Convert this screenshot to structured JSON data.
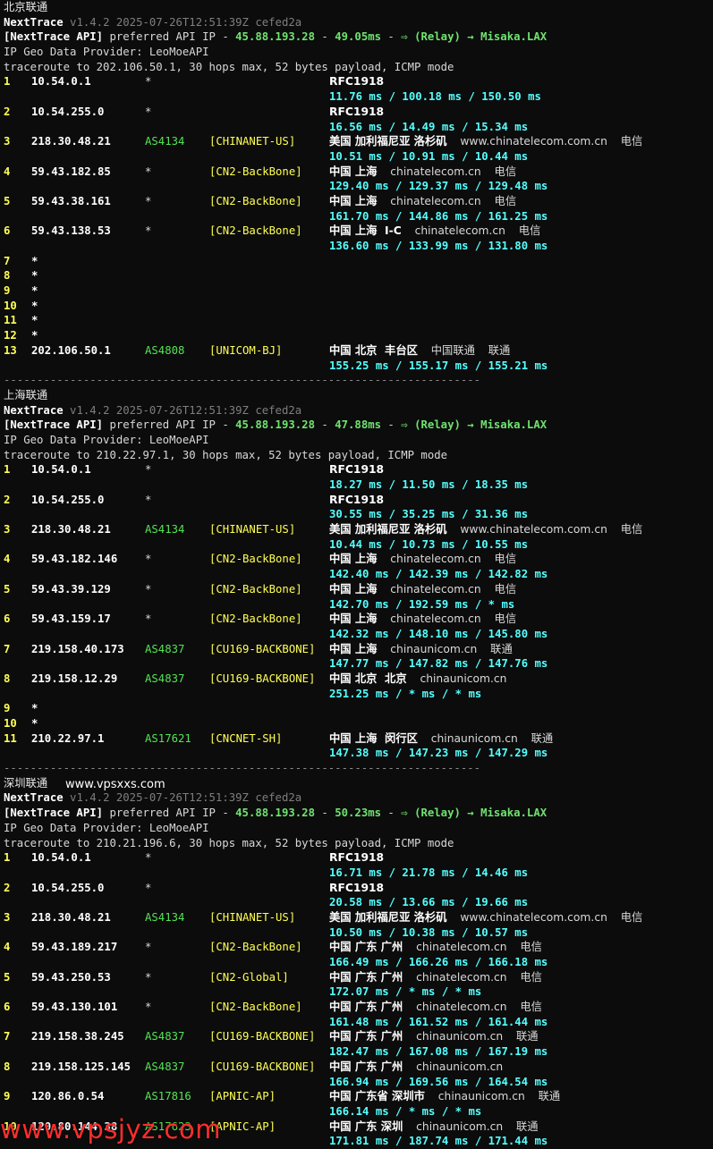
{
  "watermark": {
    "site": "www.vpsxxs.com",
    "brand": "www.vpsjyz.com"
  },
  "sections": [
    {
      "title": "北京联通",
      "app": "NextTrace",
      "version": "v1.4.2 2025-07-26T12:51:39Z cefed2a",
      "api_tag": "[NextTrace API]",
      "api_text": "preferred API IP -",
      "api_ip": "45.88.193.28",
      "api_ms": "49.05ms",
      "api_route": "(Relay) → Misaka.LAX",
      "geo_provider": "IP Geo Data Provider: LeoMoeAPI",
      "traceroute": "traceroute to 202.106.50.1, 30 hops max, 52 bytes payload, ICMP mode",
      "hops": [
        {
          "n": "1",
          "ip": "10.54.0.1",
          "asn": "*",
          "tag": "",
          "geo": "RFC1918",
          "domain": "",
          "isp": "",
          "rtt": "11.76 ms / 100.18 ms / 150.50 ms"
        },
        {
          "n": "2",
          "ip": "10.54.255.0",
          "asn": "*",
          "tag": "",
          "geo": "RFC1918",
          "domain": "",
          "isp": "",
          "rtt": "16.56 ms / 14.49 ms / 15.34 ms"
        },
        {
          "n": "3",
          "ip": "218.30.48.21",
          "asn": "AS4134",
          "tag": "[CHINANET-US]",
          "geo": "美国 加利福尼亚 洛杉矶",
          "domain": "www.chinatelecom.com.cn",
          "isp": "电信",
          "rtt": "10.51 ms / 10.91 ms / 10.44 ms"
        },
        {
          "n": "4",
          "ip": "59.43.182.85",
          "asn": "*",
          "tag": "[CN2-BackBone]",
          "geo": "中国 上海",
          "domain": "chinatelecom.cn",
          "isp": "电信",
          "rtt": "129.40 ms / 129.37 ms / 129.48 ms"
        },
        {
          "n": "5",
          "ip": "59.43.38.161",
          "asn": "*",
          "tag": "[CN2-BackBone]",
          "geo": "中国 上海",
          "domain": "chinatelecom.cn",
          "isp": "电信",
          "rtt": "161.70 ms / 144.86 ms / 161.25 ms"
        },
        {
          "n": "6",
          "ip": "59.43.138.53",
          "asn": "*",
          "tag": "[CN2-BackBone]",
          "geo": "中国 上海  I-C",
          "domain": "chinatelecom.cn",
          "isp": "电信",
          "rtt": "136.60 ms / 133.99 ms / 131.80 ms"
        },
        {
          "n": "7",
          "ip": "*",
          "asn": "",
          "tag": "",
          "geo": "",
          "domain": "",
          "isp": "",
          "rtt": ""
        },
        {
          "n": "8",
          "ip": "*",
          "asn": "",
          "tag": "",
          "geo": "",
          "domain": "",
          "isp": "",
          "rtt": ""
        },
        {
          "n": "9",
          "ip": "*",
          "asn": "",
          "tag": "",
          "geo": "",
          "domain": "",
          "isp": "",
          "rtt": ""
        },
        {
          "n": "10",
          "ip": "*",
          "asn": "",
          "tag": "",
          "geo": "",
          "domain": "",
          "isp": "",
          "rtt": ""
        },
        {
          "n": "11",
          "ip": "*",
          "asn": "",
          "tag": "",
          "geo": "",
          "domain": "",
          "isp": "",
          "rtt": ""
        },
        {
          "n": "12",
          "ip": "*",
          "asn": "",
          "tag": "",
          "geo": "",
          "domain": "",
          "isp": "",
          "rtt": ""
        },
        {
          "n": "13",
          "ip": "202.106.50.1",
          "asn": "AS4808",
          "tag": "[UNICOM-BJ]",
          "geo": "中国 北京  丰台区",
          "domain": "中国联通",
          "isp": "联通",
          "rtt": "155.25 ms / 155.17 ms / 155.21 ms"
        }
      ],
      "separator": "------------------------------------------------------------------------"
    },
    {
      "title": "上海联通",
      "app": "NextTrace",
      "version": "v1.4.2 2025-07-26T12:51:39Z cefed2a",
      "api_tag": "[NextTrace API]",
      "api_text": "preferred API IP -",
      "api_ip": "45.88.193.28",
      "api_ms": "47.88ms",
      "api_route": "(Relay) → Misaka.LAX",
      "geo_provider": "IP Geo Data Provider: LeoMoeAPI",
      "traceroute": "traceroute to 210.22.97.1, 30 hops max, 52 bytes payload, ICMP mode",
      "hops": [
        {
          "n": "1",
          "ip": "10.54.0.1",
          "asn": "*",
          "tag": "",
          "geo": "RFC1918",
          "domain": "",
          "isp": "",
          "rtt": "18.27 ms / 11.50 ms / 18.35 ms"
        },
        {
          "n": "2",
          "ip": "10.54.255.0",
          "asn": "*",
          "tag": "",
          "geo": "RFC1918",
          "domain": "",
          "isp": "",
          "rtt": "30.55 ms / 35.25 ms / 31.36 ms"
        },
        {
          "n": "3",
          "ip": "218.30.48.21",
          "asn": "AS4134",
          "tag": "[CHINANET-US]",
          "geo": "美国 加利福尼亚 洛杉矶",
          "domain": "www.chinatelecom.com.cn",
          "isp": "电信",
          "rtt": "10.44 ms / 10.73 ms / 10.55 ms"
        },
        {
          "n": "4",
          "ip": "59.43.182.146",
          "asn": "*",
          "tag": "[CN2-BackBone]",
          "geo": "中国 上海",
          "domain": "chinatelecom.cn",
          "isp": "电信",
          "rtt": "142.40 ms / 142.39 ms / 142.82 ms"
        },
        {
          "n": "5",
          "ip": "59.43.39.129",
          "asn": "*",
          "tag": "[CN2-BackBone]",
          "geo": "中国 上海",
          "domain": "chinatelecom.cn",
          "isp": "电信",
          "rtt": "142.70 ms / 192.59 ms / * ms"
        },
        {
          "n": "6",
          "ip": "59.43.159.17",
          "asn": "*",
          "tag": "[CN2-BackBone]",
          "geo": "中国 上海",
          "domain": "chinatelecom.cn",
          "isp": "电信",
          "rtt": "142.32 ms / 148.10 ms / 145.80 ms"
        },
        {
          "n": "7",
          "ip": "219.158.40.173",
          "asn": "AS4837",
          "tag": "[CU169-BACKBONE]",
          "geo": "中国 上海",
          "domain": "chinaunicom.cn",
          "isp": "联通",
          "rtt": "147.77 ms / 147.82 ms / 147.76 ms"
        },
        {
          "n": "8",
          "ip": "219.158.12.29",
          "asn": "AS4837",
          "tag": "[CU169-BACKBONE]",
          "geo": "中国 北京  北京",
          "domain": "chinaunicom.cn",
          "isp": "",
          "rtt": "251.25 ms / * ms / * ms"
        },
        {
          "n": "9",
          "ip": "*",
          "asn": "",
          "tag": "",
          "geo": "",
          "domain": "",
          "isp": "",
          "rtt": ""
        },
        {
          "n": "10",
          "ip": "*",
          "asn": "",
          "tag": "",
          "geo": "",
          "domain": "",
          "isp": "",
          "rtt": ""
        },
        {
          "n": "11",
          "ip": "210.22.97.1",
          "asn": "AS17621",
          "tag": "[CNCNET-SH]",
          "geo": "中国 上海  闵行区",
          "domain": "chinaunicom.cn",
          "isp": "联通",
          "rtt": "147.38 ms / 147.23 ms / 147.29 ms"
        }
      ],
      "separator": "------------------------------------------------------------------------"
    },
    {
      "title": "深圳联通",
      "app": "NextTrace",
      "version": "v1.4.2 2025-07-26T12:51:39Z cefed2a",
      "api_tag": "[NextTrace API]",
      "api_text": "preferred API IP -",
      "api_ip": "45.88.193.28",
      "api_ms": "50.23ms",
      "api_route": "(Relay) → Misaka.LAX",
      "geo_provider": "IP Geo Data Provider: LeoMoeAPI",
      "traceroute": "traceroute to 210.21.196.6, 30 hops max, 52 bytes payload, ICMP mode",
      "hops": [
        {
          "n": "1",
          "ip": "10.54.0.1",
          "asn": "*",
          "tag": "",
          "geo": "RFC1918",
          "domain": "",
          "isp": "",
          "rtt": "16.71 ms / 21.78 ms / 14.46 ms"
        },
        {
          "n": "2",
          "ip": "10.54.255.0",
          "asn": "*",
          "tag": "",
          "geo": "RFC1918",
          "domain": "",
          "isp": "",
          "rtt": "20.58 ms / 13.66 ms / 19.66 ms"
        },
        {
          "n": "3",
          "ip": "218.30.48.21",
          "asn": "AS4134",
          "tag": "[CHINANET-US]",
          "geo": "美国 加利福尼亚 洛杉矶",
          "domain": "www.chinatelecom.com.cn",
          "isp": "电信",
          "rtt": "10.50 ms / 10.38 ms / 10.57 ms"
        },
        {
          "n": "4",
          "ip": "59.43.189.217",
          "asn": "*",
          "tag": "[CN2-BackBone]",
          "geo": "中国 广东 广州",
          "domain": "chinatelecom.cn",
          "isp": "电信",
          "rtt": "166.49 ms / 166.26 ms / 166.18 ms"
        },
        {
          "n": "5",
          "ip": "59.43.250.53",
          "asn": "*",
          "tag": "[CN2-Global]",
          "geo": "中国 广东 广州",
          "domain": "chinatelecom.cn",
          "isp": "电信",
          "rtt": "172.07 ms / * ms / * ms"
        },
        {
          "n": "6",
          "ip": "59.43.130.101",
          "asn": "*",
          "tag": "[CN2-BackBone]",
          "geo": "中国 广东 广州",
          "domain": "chinatelecom.cn",
          "isp": "电信",
          "rtt": "161.48 ms / 161.52 ms / 161.44 ms"
        },
        {
          "n": "7",
          "ip": "219.158.38.245",
          "asn": "AS4837",
          "tag": "[CU169-BACKBONE]",
          "geo": "中国 广东 广州",
          "domain": "chinaunicom.cn",
          "isp": "联通",
          "rtt": "182.47 ms / 167.08 ms / 167.19 ms"
        },
        {
          "n": "8",
          "ip": "219.158.125.145",
          "asn": "AS4837",
          "tag": "[CU169-BACKBONE]",
          "geo": "中国 广东 广州",
          "domain": "chinaunicom.cn",
          "isp": "",
          "rtt": "166.94 ms / 169.56 ms / 164.54 ms"
        },
        {
          "n": "9",
          "ip": "120.86.0.54",
          "asn": "AS17816",
          "tag": "[APNIC-AP]",
          "geo": "中国 广东省 深圳市",
          "domain": "chinaunicom.cn",
          "isp": "联通",
          "rtt": "166.14 ms / * ms / * ms"
        },
        {
          "n": "10",
          "ip": "120.80.144.38",
          "asn": "AS17623",
          "tag": "[APNIC-AP]",
          "geo": "中国 广东 深圳",
          "domain": "chinaunicom.cn",
          "isp": "联通",
          "rtt": "171.81 ms / 187.74 ms / 171.44 ms"
        }
      ]
    }
  ]
}
